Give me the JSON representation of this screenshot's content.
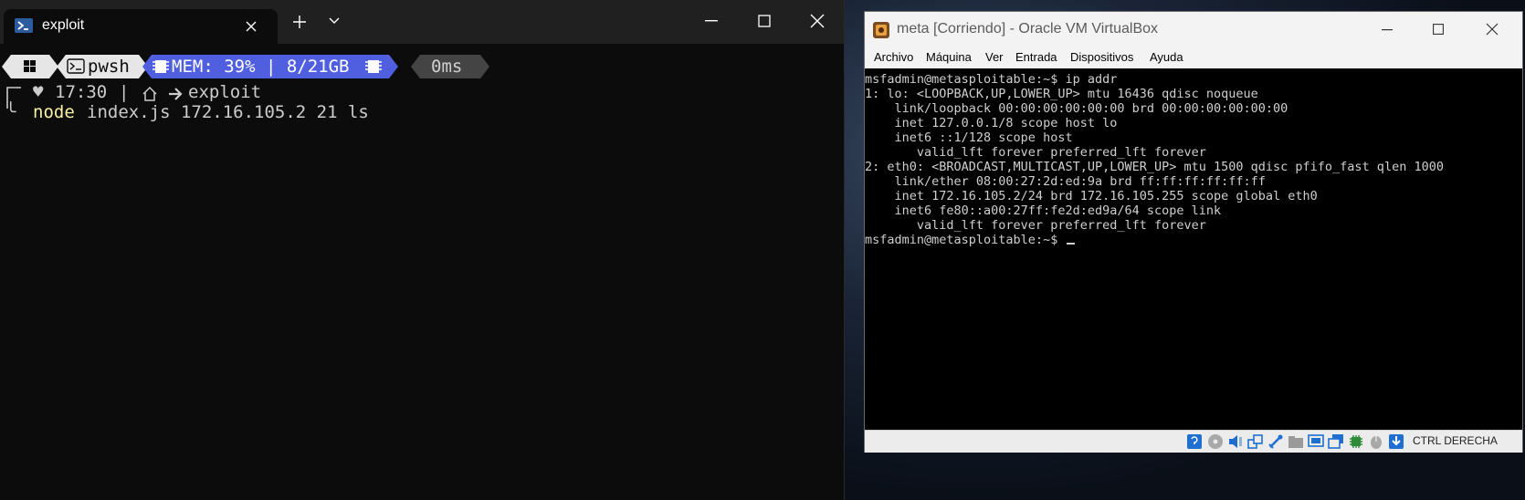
{
  "terminal": {
    "tab_title": "exploit",
    "controls": {
      "new_tab": "+",
      "minimize": "minimize",
      "maximize": "maximize",
      "close": "close"
    },
    "prompt": {
      "os_icon": "windows-icon",
      "shell": "pwsh",
      "mem": "MEM: 39% | 8/21GB",
      "duration": "0ms",
      "time": "17:30",
      "separator": "|",
      "folder": "exploit",
      "command_name": "node",
      "command_args": "index.js 172.16.105.2 21 ls"
    },
    "colors": {
      "background": "#0c0c0c",
      "segment_light": "#e6e6e6",
      "segment_mem": "#4f5fe0",
      "segment_time": "#444444",
      "command": "#f9f1a5"
    }
  },
  "virtualbox": {
    "title": "meta [Corriendo] - Oracle VM VirtualBox",
    "menu": [
      "Archivo",
      "Máquina",
      "Ver",
      "Entrada",
      "Dispositivos",
      "Ayuda"
    ],
    "console_lines": [
      "msfadmin@metasploitable:~$ ip addr",
      "1: lo: <LOOPBACK,UP,LOWER_UP> mtu 16436 qdisc noqueue",
      "    link/loopback 00:00:00:00:00:00 brd 00:00:00:00:00:00",
      "    inet 127.0.0.1/8 scope host lo",
      "    inet6 ::1/128 scope host",
      "       valid_lft forever preferred_lft forever",
      "2: eth0: <BROADCAST,MULTICAST,UP,LOWER_UP> mtu 1500 qdisc pfifo_fast qlen 1000",
      "    link/ether 08:00:27:2d:ed:9a brd ff:ff:ff:ff:ff:ff",
      "    inet 172.16.105.2/24 brd 172.16.105.255 scope global eth0",
      "    inet6 fe80::a00:27ff:fe2d:ed9a/64 scope link",
      "       valid_lft forever preferred_lft forever",
      "msfadmin@metasploitable:~$ "
    ],
    "host_key": "CTRL DERECHA",
    "status_icons": [
      "optical-drive-icon",
      "cd-icon",
      "audio-icon",
      "network-icon",
      "usb-icon",
      "shared-folder-icon",
      "display-icon",
      "capture-icon",
      "cpu-icon",
      "mouse-integration-icon",
      "download-icon"
    ]
  }
}
